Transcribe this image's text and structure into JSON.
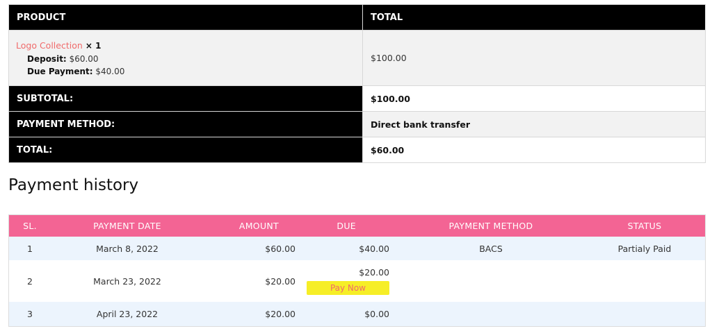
{
  "order": {
    "header": {
      "product": "PRODUCT",
      "total": "TOTAL"
    },
    "item": {
      "name": "Logo Collection",
      "qty": "× 1",
      "deposit_label": "Deposit:",
      "deposit_value": "$60.00",
      "due_label": "Due Payment:",
      "due_value": "$40.00",
      "total": "$100.00"
    },
    "subtotal": {
      "label": "SUBTOTAL:",
      "value": "$100.00"
    },
    "payment_method": {
      "label": "PAYMENT METHOD:",
      "value": "Direct bank transfer"
    },
    "total": {
      "label": "TOTAL:",
      "value": "$60.00"
    }
  },
  "history": {
    "title": "Payment history",
    "columns": {
      "sl": "SL.",
      "date": "PAYMENT DATE",
      "amount": "AMOUNT",
      "due": "DUE",
      "method": "PAYMENT METHOD",
      "status": "STATUS"
    },
    "rows": [
      {
        "sl": "1",
        "date": "March 8, 2022",
        "amount": "$60.00",
        "due": "$40.00",
        "method": "BACS",
        "status": "Partialy Paid"
      },
      {
        "sl": "2",
        "date": "March 23, 2022",
        "amount": "$20.00",
        "due": "$20.00",
        "action": "Pay Now",
        "method": "",
        "status": ""
      },
      {
        "sl": "3",
        "date": "April 23, 2022",
        "amount": "$20.00",
        "due": "$0.00",
        "method": "",
        "status": ""
      }
    ]
  },
  "colors": {
    "header_bg": "#000000",
    "history_header": "#f36494",
    "link": "#f06b6b",
    "pay_now_bg": "#f6ee27",
    "row_alt": "#ecf4fd"
  }
}
